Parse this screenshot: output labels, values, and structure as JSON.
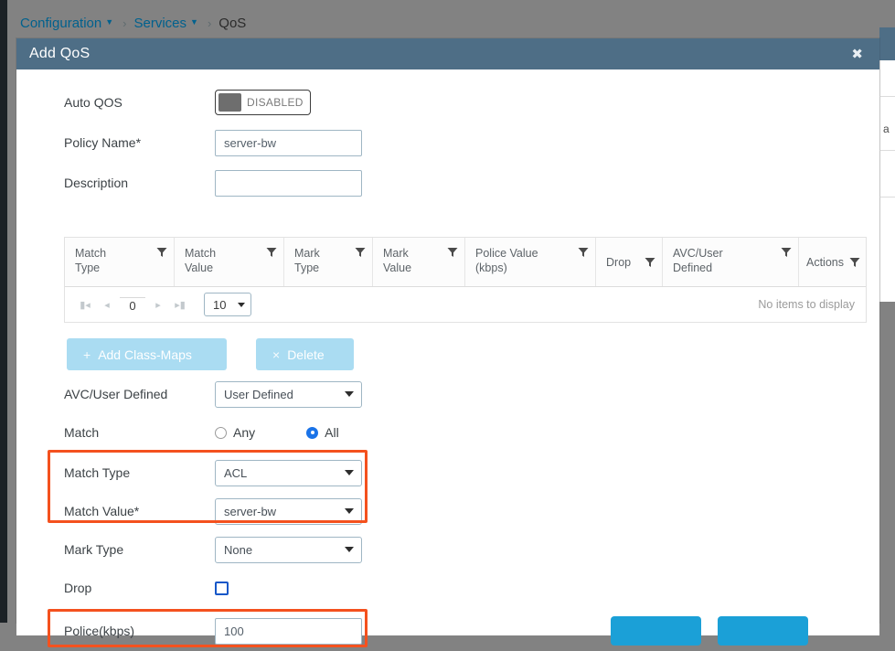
{
  "breadcrumb": {
    "items": [
      {
        "label": "Configuration",
        "has_caret": true,
        "is_link": true
      },
      {
        "label": "Services",
        "has_caret": true,
        "is_link": true
      },
      {
        "label": "QoS",
        "has_caret": false,
        "is_link": false
      }
    ],
    "separator": "›"
  },
  "modal": {
    "title": "Add QoS",
    "close_icon": "✖"
  },
  "form": {
    "auto_qos": {
      "label": "Auto QOS",
      "toggle_state": "DISABLED"
    },
    "policy_name": {
      "label": "Policy Name*",
      "value": "server-bw",
      "placeholder": ""
    },
    "description": {
      "label": "Description",
      "value": "",
      "placeholder": ""
    },
    "avc_user_defined": {
      "label": "AVC/User Defined",
      "value": "User Defined"
    },
    "match": {
      "label": "Match",
      "options": [
        {
          "label": "Any",
          "selected": false
        },
        {
          "label": "All",
          "selected": true
        }
      ]
    },
    "match_type": {
      "label": "Match Type",
      "value": "ACL"
    },
    "match_value": {
      "label": "Match Value*",
      "value": "server-bw"
    },
    "mark_type": {
      "label": "Mark Type",
      "value": "None"
    },
    "drop": {
      "label": "Drop",
      "checked": false
    },
    "police": {
      "label": "Police(kbps)",
      "value": "100",
      "placeholder": ""
    }
  },
  "grid": {
    "columns": [
      {
        "label": "Match\nType",
        "filter": true
      },
      {
        "label": "Match\nValue",
        "filter": true
      },
      {
        "label": "Mark\nType",
        "filter": true
      },
      {
        "label": "Mark\nValue",
        "filter": true
      },
      {
        "label": "Police Value\n(kbps)",
        "filter": true
      },
      {
        "label": "Drop",
        "filter": true
      },
      {
        "label": "AVC/User\nDefined",
        "filter": true
      },
      {
        "label": "Actions",
        "filter": true
      }
    ],
    "rows": [],
    "empty_message": "No items to display",
    "pager": {
      "first_icon": "⏮",
      "prev_icon": "◀",
      "page": "0",
      "next_icon": "▶",
      "last_icon": "⏭",
      "page_size": "10"
    },
    "actions": {
      "add_label": "Add Class-Maps",
      "add_icon": "+",
      "delete_label": "Delete",
      "delete_icon": "×"
    }
  },
  "footer": {
    "primary_label": "",
    "secondary_label": ""
  },
  "colors": {
    "header_bar": "#4e6e86",
    "breadcrumb_link": "#00618e",
    "highlight": "#f4511e",
    "accent_blue": "#1ba0d7",
    "radio_selected": "#1a73e8",
    "checkbox_border": "#1657c8",
    "disabled_button": "#aadcf2",
    "backdrop": "#828282"
  },
  "background_peek": {
    "text": "a"
  }
}
